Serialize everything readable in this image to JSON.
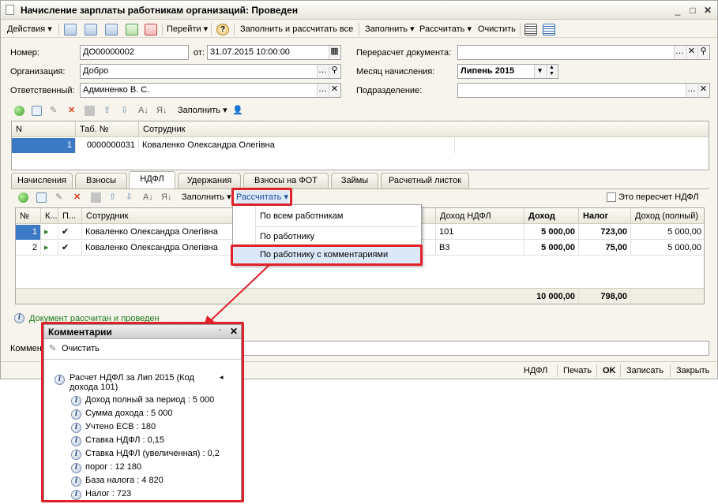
{
  "window": {
    "title": "Начисление зарплаты работникам организаций: Проведен"
  },
  "toolbar": {
    "actions": "Действия",
    "goto": "Перейти",
    "fill_calc_all": "Заполнить и рассчитать все",
    "fill": "Заполнить",
    "calculate": "Рассчитать",
    "clear": "Очистить"
  },
  "form": {
    "number_label": "Номер:",
    "number": "ДО00000002",
    "from_label": "от:",
    "date": "31.07.2015 10:00:00",
    "org_label": "Организация:",
    "org": "Добро",
    "responsible_label": "Ответственный:",
    "responsible": "Админенко В. С.",
    "recalc_label": "Перерасчет документа:",
    "recalc": "",
    "month_label": "Месяц начисления:",
    "month": "Липень 2015",
    "division_label": "Подразделение:",
    "division": ""
  },
  "emp_toolbar": {
    "fill": "Заполнить"
  },
  "employees": {
    "headers": [
      "N",
      "Таб. №",
      "Сотрудник"
    ],
    "rows": [
      {
        "n": "1",
        "tab": "0000000031",
        "name": "Коваленко Олександра Олегівна"
      }
    ]
  },
  "tabs": [
    "Начисления",
    "Взносы",
    "НДФЛ",
    "Удержания",
    "Взносы на ФОТ",
    "Займы",
    "Расчетный листок"
  ],
  "ndfl_toolbar": {
    "fill": "Заполнить",
    "calculate": "Рассчитать",
    "recalc_check": "Это пересчет НДФЛ"
  },
  "menu": {
    "items": [
      "По всем работникам",
      "По работнику",
      "По работнику с комментариями"
    ]
  },
  "ndfl_table": {
    "headers": [
      "№",
      "К...",
      "П...",
      "Сотрудник",
      "Доход НДФЛ",
      "Доход",
      "Налог",
      "Доход (полный)"
    ],
    "rows": [
      {
        "n": "1",
        "name": "Коваленко Олександра Олегівна",
        "code": "101",
        "income": "5 000,00",
        "tax": "723,00",
        "full": "5 000,00"
      },
      {
        "n": "2",
        "name": "Коваленко Олександра Олегівна",
        "code": "В3",
        "income": "5 000,00",
        "tax": "75,00",
        "full": "5 000,00"
      }
    ],
    "total_income": "10 000,00",
    "total_tax": "798,00"
  },
  "status": "Документ рассчитан и проведен",
  "comment_label": "Коммент",
  "bottom": {
    "ndfl": "НДФЛ",
    "print": "Печать",
    "ok": "OK",
    "save": "Записать",
    "close": "Закрыть"
  },
  "comments_panel": {
    "title": "Комментарии",
    "clear": "Очистить",
    "group": "Расчет НДФЛ за Лип 2015 (Код дохода 101)",
    "group_line1": "Расчет НДФЛ за Лип 2015 (Код",
    "group_line2": "дохода 101)",
    "items": [
      "Доход полный за период : 5 000",
      "Сумма дохода : 5 000",
      "Учтено ЕСВ : 180",
      "Ставка НДФЛ : 0,15",
      "Ставка НДФЛ (увеличенная) : 0,2",
      "порог : 12 180",
      "База налога : 4 820",
      "Налог : 723"
    ]
  },
  "colors": {
    "accent": "#e0202a",
    "selection": "#3d7ac6",
    "highlight": "#dce8f8",
    "status_text": "#1a7a1a"
  }
}
